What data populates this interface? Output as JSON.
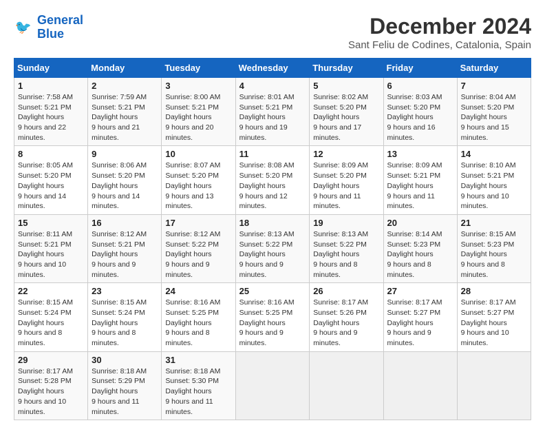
{
  "logo": {
    "text_general": "General",
    "text_blue": "Blue"
  },
  "title": "December 2024",
  "subtitle": "Sant Feliu de Codines, Catalonia, Spain",
  "weekdays": [
    "Sunday",
    "Monday",
    "Tuesday",
    "Wednesday",
    "Thursday",
    "Friday",
    "Saturday"
  ],
  "weeks": [
    [
      {
        "day": "1",
        "sunrise": "7:58 AM",
        "sunset": "5:21 PM",
        "daylight": "9 hours and 22 minutes."
      },
      {
        "day": "2",
        "sunrise": "7:59 AM",
        "sunset": "5:21 PM",
        "daylight": "9 hours and 21 minutes."
      },
      {
        "day": "3",
        "sunrise": "8:00 AM",
        "sunset": "5:21 PM",
        "daylight": "9 hours and 20 minutes."
      },
      {
        "day": "4",
        "sunrise": "8:01 AM",
        "sunset": "5:21 PM",
        "daylight": "9 hours and 19 minutes."
      },
      {
        "day": "5",
        "sunrise": "8:02 AM",
        "sunset": "5:20 PM",
        "daylight": "9 hours and 17 minutes."
      },
      {
        "day": "6",
        "sunrise": "8:03 AM",
        "sunset": "5:20 PM",
        "daylight": "9 hours and 16 minutes."
      },
      {
        "day": "7",
        "sunrise": "8:04 AM",
        "sunset": "5:20 PM",
        "daylight": "9 hours and 15 minutes."
      }
    ],
    [
      {
        "day": "8",
        "sunrise": "8:05 AM",
        "sunset": "5:20 PM",
        "daylight": "9 hours and 14 minutes."
      },
      {
        "day": "9",
        "sunrise": "8:06 AM",
        "sunset": "5:20 PM",
        "daylight": "9 hours and 14 minutes."
      },
      {
        "day": "10",
        "sunrise": "8:07 AM",
        "sunset": "5:20 PM",
        "daylight": "9 hours and 13 minutes."
      },
      {
        "day": "11",
        "sunrise": "8:08 AM",
        "sunset": "5:20 PM",
        "daylight": "9 hours and 12 minutes."
      },
      {
        "day": "12",
        "sunrise": "8:09 AM",
        "sunset": "5:20 PM",
        "daylight": "9 hours and 11 minutes."
      },
      {
        "day": "13",
        "sunrise": "8:09 AM",
        "sunset": "5:21 PM",
        "daylight": "9 hours and 11 minutes."
      },
      {
        "day": "14",
        "sunrise": "8:10 AM",
        "sunset": "5:21 PM",
        "daylight": "9 hours and 10 minutes."
      }
    ],
    [
      {
        "day": "15",
        "sunrise": "8:11 AM",
        "sunset": "5:21 PM",
        "daylight": "9 hours and 10 minutes."
      },
      {
        "day": "16",
        "sunrise": "8:12 AM",
        "sunset": "5:21 PM",
        "daylight": "9 hours and 9 minutes."
      },
      {
        "day": "17",
        "sunrise": "8:12 AM",
        "sunset": "5:22 PM",
        "daylight": "9 hours and 9 minutes."
      },
      {
        "day": "18",
        "sunrise": "8:13 AM",
        "sunset": "5:22 PM",
        "daylight": "9 hours and 9 minutes."
      },
      {
        "day": "19",
        "sunrise": "8:13 AM",
        "sunset": "5:22 PM",
        "daylight": "9 hours and 8 minutes."
      },
      {
        "day": "20",
        "sunrise": "8:14 AM",
        "sunset": "5:23 PM",
        "daylight": "9 hours and 8 minutes."
      },
      {
        "day": "21",
        "sunrise": "8:15 AM",
        "sunset": "5:23 PM",
        "daylight": "9 hours and 8 minutes."
      }
    ],
    [
      {
        "day": "22",
        "sunrise": "8:15 AM",
        "sunset": "5:24 PM",
        "daylight": "9 hours and 8 minutes."
      },
      {
        "day": "23",
        "sunrise": "8:15 AM",
        "sunset": "5:24 PM",
        "daylight": "9 hours and 8 minutes."
      },
      {
        "day": "24",
        "sunrise": "8:16 AM",
        "sunset": "5:25 PM",
        "daylight": "9 hours and 8 minutes."
      },
      {
        "day": "25",
        "sunrise": "8:16 AM",
        "sunset": "5:25 PM",
        "daylight": "9 hours and 9 minutes."
      },
      {
        "day": "26",
        "sunrise": "8:17 AM",
        "sunset": "5:26 PM",
        "daylight": "9 hours and 9 minutes."
      },
      {
        "day": "27",
        "sunrise": "8:17 AM",
        "sunset": "5:27 PM",
        "daylight": "9 hours and 9 minutes."
      },
      {
        "day": "28",
        "sunrise": "8:17 AM",
        "sunset": "5:27 PM",
        "daylight": "9 hours and 10 minutes."
      }
    ],
    [
      {
        "day": "29",
        "sunrise": "8:17 AM",
        "sunset": "5:28 PM",
        "daylight": "9 hours and 10 minutes."
      },
      {
        "day": "30",
        "sunrise": "8:18 AM",
        "sunset": "5:29 PM",
        "daylight": "9 hours and 11 minutes."
      },
      {
        "day": "31",
        "sunrise": "8:18 AM",
        "sunset": "5:30 PM",
        "daylight": "9 hours and 11 minutes."
      },
      null,
      null,
      null,
      null
    ]
  ],
  "labels": {
    "sunrise": "Sunrise:",
    "sunset": "Sunset:",
    "daylight": "Daylight hours"
  }
}
